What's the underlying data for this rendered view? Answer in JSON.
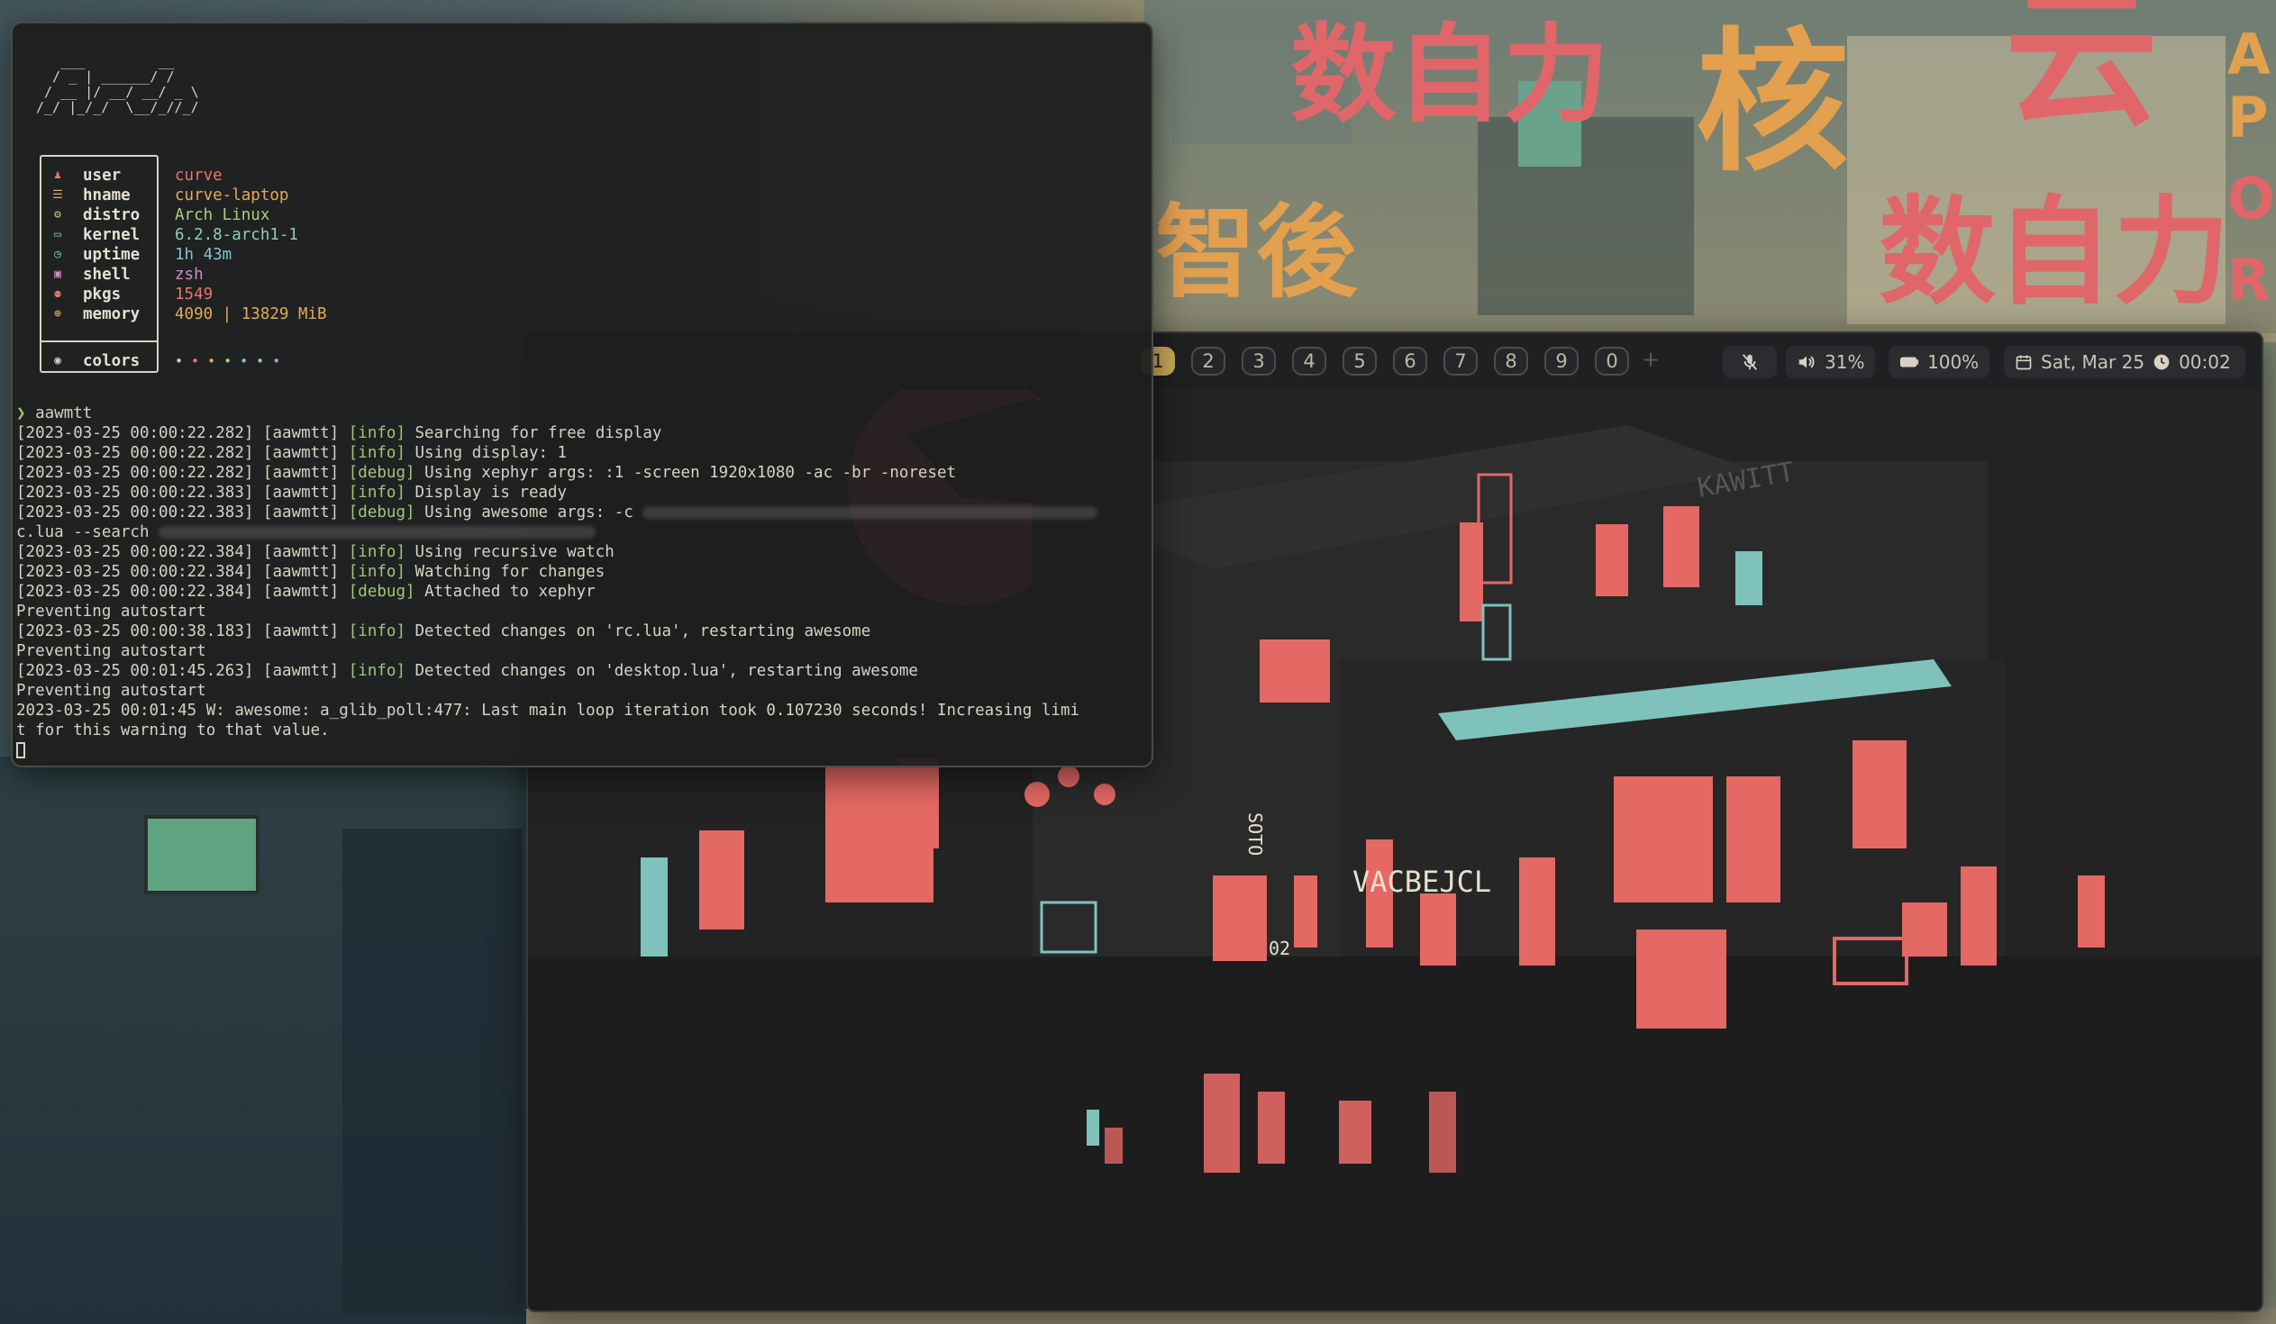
{
  "wallpaper": {
    "signs": [
      "数自力",
      "核",
      "云",
      "智後",
      "数自力",
      "A",
      "P",
      "O",
      "R"
    ]
  },
  "topbar": {
    "workspaces": [
      "1",
      "2",
      "3",
      "4",
      "5",
      "6",
      "7",
      "8",
      "9",
      "0"
    ],
    "active_workspace": "1",
    "add_label": "+",
    "mic_icon": "mic-muted-icon",
    "volume": "31%",
    "battery": "100%",
    "date": "Sat, Mar 25",
    "time": "00:02"
  },
  "xephyr_art": {
    "signs": [
      "VACBEJCL",
      "KAWITT",
      "SOTO",
      "02"
    ]
  },
  "terminal": {
    "ascii_logo": "   ___         __\n  / _ | ______/ /\n / __ |/ __/ __/ _ \\\n/_/ |_/_/  \\__/_//_/",
    "info": [
      {
        "icon": "user-icon",
        "glyph": "♟",
        "key": "user",
        "value": "curve",
        "color": "#e8766b"
      },
      {
        "icon": "hostname-icon",
        "glyph": "☰",
        "key": "hname",
        "value": "curve-laptop",
        "color": "#e0ab59"
      },
      {
        "icon": "distro-icon",
        "glyph": "⚙",
        "key": "distro",
        "value": "Arch Linux",
        "color": "#a9cf80"
      },
      {
        "icon": "kernel-icon",
        "glyph": "▭",
        "key": "kernel",
        "value": "6.2.8-arch1-1",
        "color": "#8fcfb9"
      },
      {
        "icon": "uptime-icon",
        "glyph": "◷",
        "key": "uptime",
        "value": "1h 43m",
        "color": "#7cc7cf"
      },
      {
        "icon": "shell-icon",
        "glyph": "▣",
        "key": "shell",
        "value": "zsh",
        "color": "#d58cc0"
      },
      {
        "icon": "packages-icon",
        "glyph": "⚉",
        "key": "pkgs",
        "value": "1549",
        "color": "#e8766b"
      },
      {
        "icon": "memory-icon",
        "glyph": "⊛",
        "key": "memory",
        "value": "4090 | 13829 MiB",
        "color": "#e0ab59"
      }
    ],
    "colors_row": {
      "icon": "palette-icon",
      "glyph": "◉",
      "key": "colors",
      "dots": [
        "#d6d2c4",
        "#e8766b",
        "#e0ab59",
        "#a9cf80",
        "#7cc7cf",
        "#8fcfb9",
        "#d58cc0"
      ]
    },
    "prompt_symbol": "❯",
    "command": "aawmtt",
    "log": [
      {
        "pre": "[2023-03-25 00:00:22.282] [aawmtt] ",
        "tag": "[info]",
        "tagtype": "info",
        "msg": " Searching for free display"
      },
      {
        "pre": "[2023-03-25 00:00:22.282] [aawmtt] ",
        "tag": "[info]",
        "tagtype": "info",
        "msg": " Using display: 1"
      },
      {
        "pre": "[2023-03-25 00:00:22.282] [aawmtt] ",
        "tag": "[debug]",
        "tagtype": "debug",
        "msg": " Using xephyr args: :1 -screen 1920x1080 -ac -br -noreset"
      },
      {
        "pre": "[2023-03-25 00:00:22.383] [aawmtt] ",
        "tag": "[info]",
        "tagtype": "info",
        "msg": " Display is ready"
      },
      {
        "pre": "[2023-03-25 00:00:22.383] [aawmtt] ",
        "tag": "[debug]",
        "tagtype": "debug",
        "msg": " Using awesome args: -c ",
        "blur": 505
      },
      {
        "pre": "c.lua --search ",
        "tag": "",
        "tagtype": "",
        "msg": "",
        "blur": 485
      },
      {
        "pre": "[2023-03-25 00:00:22.384] [aawmtt] ",
        "tag": "[info]",
        "tagtype": "info",
        "msg": " Using recursive watch"
      },
      {
        "pre": "[2023-03-25 00:00:22.384] [aawmtt] ",
        "tag": "[info]",
        "tagtype": "info",
        "msg": " Watching for changes"
      },
      {
        "pre": "[2023-03-25 00:00:22.384] [aawmtt] ",
        "tag": "[debug]",
        "tagtype": "debug",
        "msg": " Attached to xephyr"
      },
      {
        "pre": "Preventing autostart",
        "tag": "",
        "tagtype": "",
        "msg": ""
      },
      {
        "pre": "[2023-03-25 00:00:38.183] [aawmtt] ",
        "tag": "[info]",
        "tagtype": "info",
        "msg": " Detected changes on 'rc.lua', restarting awesome"
      },
      {
        "pre": "Preventing autostart",
        "tag": "",
        "tagtype": "",
        "msg": ""
      },
      {
        "pre": "[2023-03-25 00:01:45.263] [aawmtt] ",
        "tag": "[info]",
        "tagtype": "info",
        "msg": " Detected changes on 'desktop.lua', restarting awesome"
      },
      {
        "pre": "Preventing autostart",
        "tag": "",
        "tagtype": "",
        "msg": ""
      },
      {
        "pre": "2023-03-25 00:01:45 W: awesome: a_glib_poll:477: Last main loop iteration took 0.107230 seconds! Increasing limi",
        "tag": "",
        "tagtype": "",
        "msg": ""
      },
      {
        "pre": "t for this warning to that value.",
        "tag": "",
        "tagtype": "",
        "msg": ""
      }
    ]
  }
}
